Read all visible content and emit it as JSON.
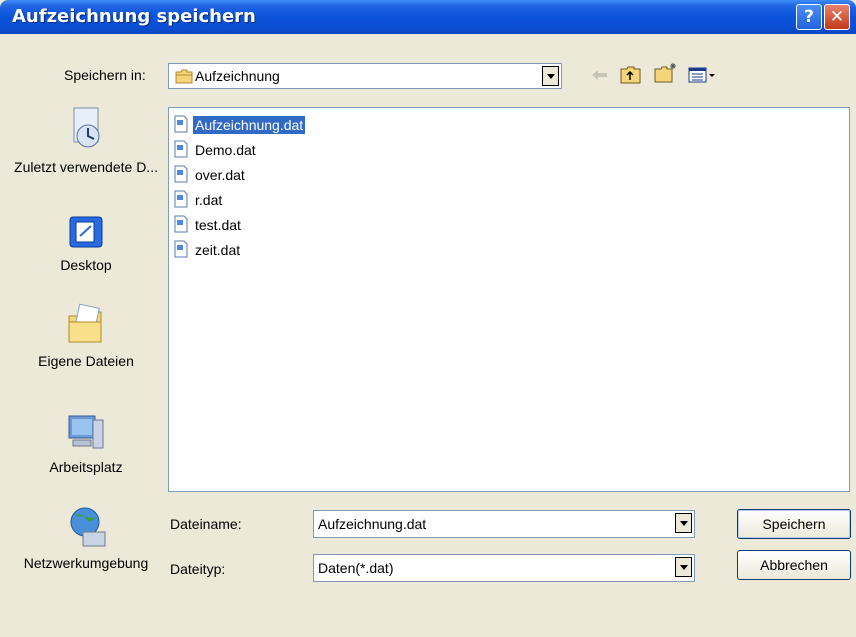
{
  "window": {
    "title": "Aufzeichnung speichern",
    "help_glyph": "?",
    "close_glyph": "✕"
  },
  "save_in": {
    "label": "Speichern in:",
    "folder": "Aufzeichnung",
    "toolbar_icons": [
      "back-arrow-icon",
      "up-folder-icon",
      "new-folder-icon",
      "view-menu-icon"
    ]
  },
  "places": [
    {
      "label": "Zuletzt verwendete D...",
      "icon": "recent-documents-icon"
    },
    {
      "label": "Desktop",
      "icon": "desktop-icon"
    },
    {
      "label": "Eigene Dateien",
      "icon": "my-documents-icon"
    },
    {
      "label": "Arbeitsplatz",
      "icon": "my-computer-icon"
    },
    {
      "label": "Netzwerkumgebung",
      "icon": "network-icon"
    }
  ],
  "files": [
    {
      "name": "Aufzeichnung.dat",
      "selected": true
    },
    {
      "name": "Demo.dat",
      "selected": false
    },
    {
      "name": "over.dat",
      "selected": false
    },
    {
      "name": "r.dat",
      "selected": false
    },
    {
      "name": "test.dat",
      "selected": false
    },
    {
      "name": "zeit.dat",
      "selected": false
    }
  ],
  "filename": {
    "label": "Dateiname:",
    "value": "Aufzeichnung.dat"
  },
  "filetype": {
    "label": "Dateityp:",
    "value": "Daten(*.dat)"
  },
  "buttons": {
    "save": "Speichern",
    "cancel": "Abbrechen"
  },
  "colors": {
    "titlebar": "#0a53d9",
    "selection": "#316ac5",
    "dialog_bg": "#ece9d8"
  }
}
